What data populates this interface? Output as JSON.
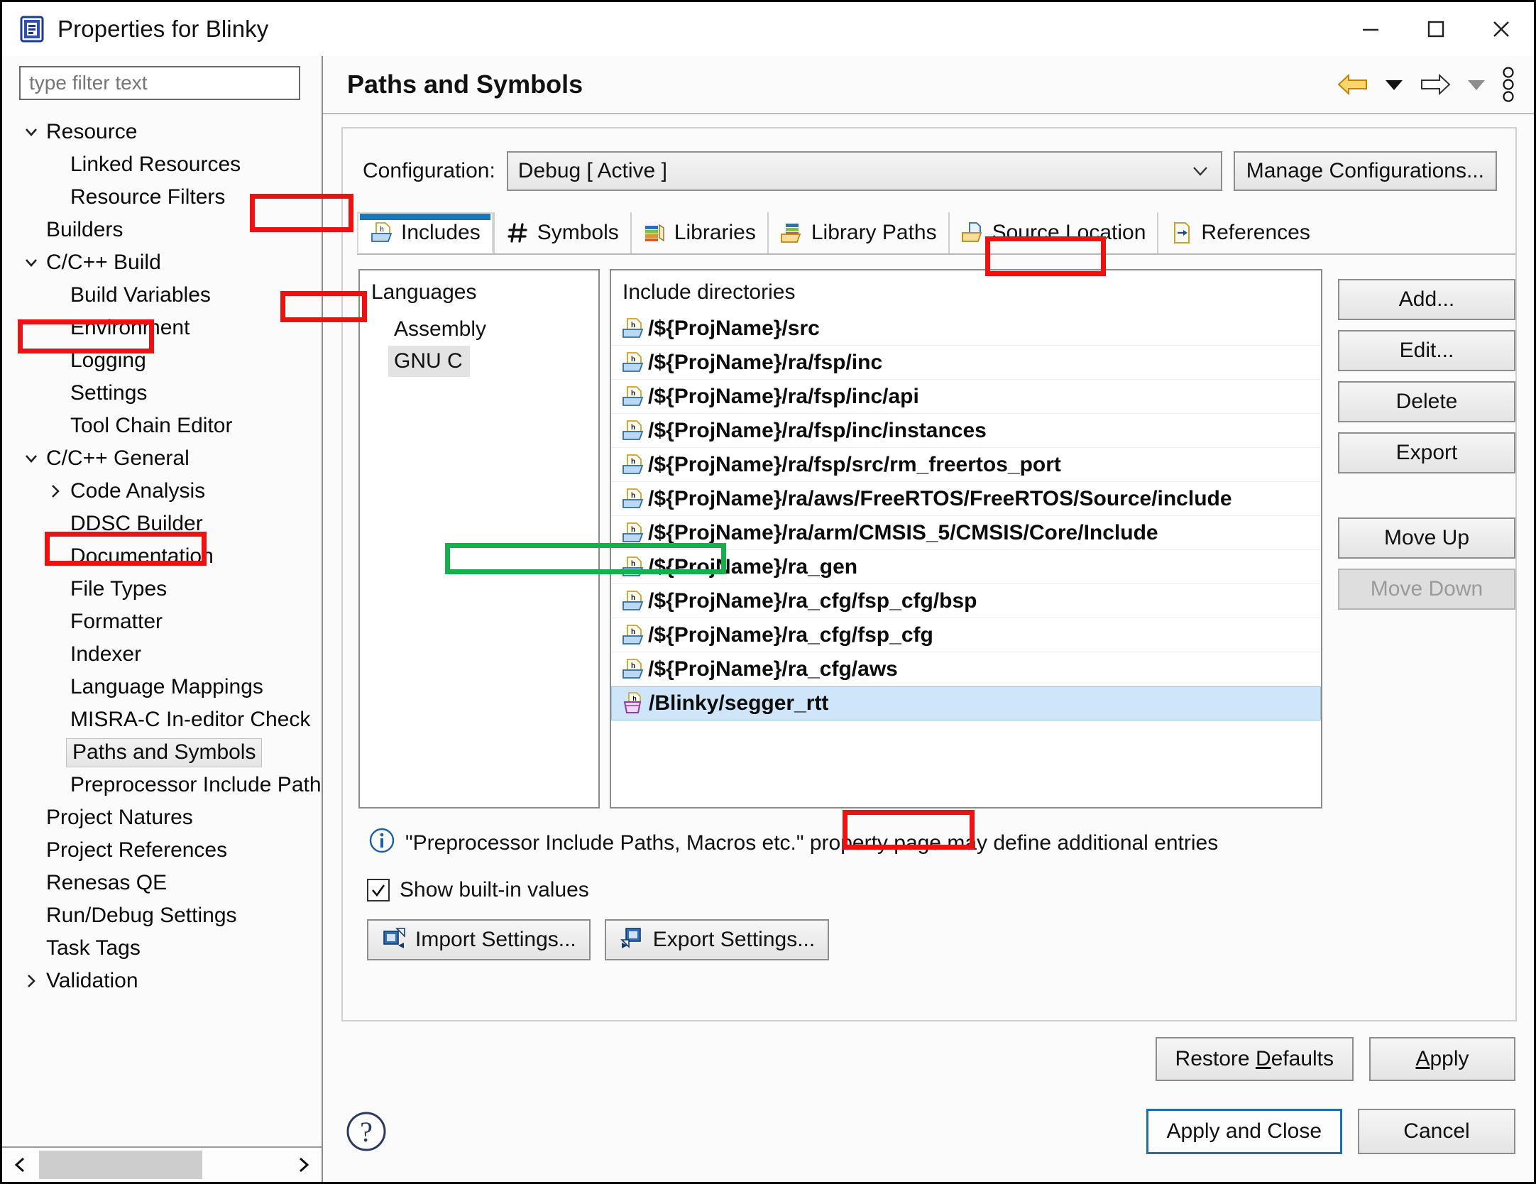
{
  "window": {
    "title": "Properties for Blinky",
    "icon": "properties-icon",
    "minimize": "minimize-icon",
    "maximize": "maximize-icon",
    "close": "close-icon"
  },
  "sidebar": {
    "filter_placeholder": "type filter text",
    "filter_value": "",
    "items": [
      {
        "label": "Resource",
        "level": 0,
        "twisty": "expanded",
        "selected": false
      },
      {
        "label": "Linked Resources",
        "level": 1,
        "twisty": "none",
        "selected": false
      },
      {
        "label": "Resource Filters",
        "level": 1,
        "twisty": "none",
        "selected": false
      },
      {
        "label": "Builders",
        "level": 0,
        "twisty": "none",
        "selected": false
      },
      {
        "label": "C/C++ Build",
        "level": 0,
        "twisty": "expanded",
        "selected": false
      },
      {
        "label": "Build Variables",
        "level": 1,
        "twisty": "none",
        "selected": false
      },
      {
        "label": "Environment",
        "level": 1,
        "twisty": "none",
        "selected": false
      },
      {
        "label": "Logging",
        "level": 1,
        "twisty": "none",
        "selected": false
      },
      {
        "label": "Settings",
        "level": 1,
        "twisty": "none",
        "selected": false
      },
      {
        "label": "Tool Chain Editor",
        "level": 1,
        "twisty": "none",
        "selected": false
      },
      {
        "label": "C/C++ General",
        "level": 0,
        "twisty": "expanded",
        "selected": false
      },
      {
        "label": "Code Analysis",
        "level": 1,
        "twisty": "collapsed",
        "selected": false
      },
      {
        "label": "DDSC Builder",
        "level": 1,
        "twisty": "none",
        "selected": false
      },
      {
        "label": "Documentation",
        "level": 1,
        "twisty": "none",
        "selected": false
      },
      {
        "label": "File Types",
        "level": 1,
        "twisty": "none",
        "selected": false
      },
      {
        "label": "Formatter",
        "level": 1,
        "twisty": "none",
        "selected": false
      },
      {
        "label": "Indexer",
        "level": 1,
        "twisty": "none",
        "selected": false
      },
      {
        "label": "Language Mappings",
        "level": 1,
        "twisty": "none",
        "selected": false
      },
      {
        "label": "MISRA-C In-editor Check",
        "level": 1,
        "twisty": "none",
        "selected": false
      },
      {
        "label": "Paths and Symbols",
        "level": 1,
        "twisty": "none",
        "selected": true
      },
      {
        "label": "Preprocessor Include Path",
        "level": 1,
        "twisty": "none",
        "selected": false
      },
      {
        "label": "Project Natures",
        "level": 0,
        "twisty": "none",
        "selected": false
      },
      {
        "label": "Project References",
        "level": 0,
        "twisty": "none",
        "selected": false
      },
      {
        "label": "Renesas QE",
        "level": 0,
        "twisty": "none",
        "selected": false
      },
      {
        "label": "Run/Debug Settings",
        "level": 0,
        "twisty": "none",
        "selected": false
      },
      {
        "label": "Task Tags",
        "level": 0,
        "twisty": "none",
        "selected": false
      },
      {
        "label": "Validation",
        "level": 0,
        "twisty": "collapsed",
        "selected": false
      }
    ],
    "scroll_left": "scroll-left-icon",
    "scroll_right": "scroll-right-icon"
  },
  "header": {
    "title": "Paths and Symbols",
    "back_icon": "back-arrow-icon",
    "back_menu_icon": "chevron-down-icon",
    "forward_icon": "forward-arrow-icon",
    "forward_menu_icon": "chevron-down-icon",
    "menu_icon": "vertical-dots-icon"
  },
  "configuration": {
    "label": "Configuration:",
    "value": "Debug  [ Active ]",
    "dropdown_icon": "chevron-down-icon",
    "manage_button": "Manage Configurations..."
  },
  "tabs": [
    {
      "label": "Includes",
      "icon": "include-folder-icon",
      "active": true
    },
    {
      "label": "Symbols",
      "icon": "hash-icon",
      "active": false
    },
    {
      "label": "Libraries",
      "icon": "libraries-icon",
      "active": false
    },
    {
      "label": "Library Paths",
      "icon": "library-paths-icon",
      "active": false
    },
    {
      "label": "Source Location",
      "icon": "source-location-icon",
      "active": false
    },
    {
      "label": "References",
      "icon": "references-icon",
      "active": false
    }
  ],
  "languages": {
    "title": "Languages",
    "items": [
      {
        "label": "Assembly",
        "selected": false
      },
      {
        "label": "GNU C",
        "selected": true
      }
    ]
  },
  "includes": {
    "title": "Include directories",
    "entries": [
      {
        "path": "/${ProjName}/src",
        "icon": "include-folder-icon",
        "selected": false
      },
      {
        "path": "/${ProjName}/ra/fsp/inc",
        "icon": "include-folder-icon",
        "selected": false
      },
      {
        "path": "/${ProjName}/ra/fsp/inc/api",
        "icon": "include-folder-icon",
        "selected": false
      },
      {
        "path": "/${ProjName}/ra/fsp/inc/instances",
        "icon": "include-folder-icon",
        "selected": false
      },
      {
        "path": "/${ProjName}/ra/fsp/src/rm_freertos_port",
        "icon": "include-folder-icon",
        "selected": false
      },
      {
        "path": "/${ProjName}/ra/aws/FreeRTOS/FreeRTOS/Source/include",
        "icon": "include-folder-icon",
        "selected": false
      },
      {
        "path": "/${ProjName}/ra/arm/CMSIS_5/CMSIS/Core/Include",
        "icon": "include-folder-icon",
        "selected": false
      },
      {
        "path": "/${ProjName}/ra_gen",
        "icon": "include-folder-icon",
        "selected": false
      },
      {
        "path": "/${ProjName}/ra_cfg/fsp_cfg/bsp",
        "icon": "include-folder-icon",
        "selected": false
      },
      {
        "path": "/${ProjName}/ra_cfg/fsp_cfg",
        "icon": "include-folder-icon",
        "selected": false
      },
      {
        "path": "/${ProjName}/ra_cfg/aws",
        "icon": "include-folder-icon",
        "selected": false
      },
      {
        "path": "/Blinky/segger_rtt",
        "icon": "workspace-folder-icon",
        "selected": true
      }
    ]
  },
  "side_buttons": [
    {
      "label": "Add...",
      "disabled": false
    },
    {
      "label": "Edit...",
      "disabled": false
    },
    {
      "label": "Delete",
      "disabled": false
    },
    {
      "label": "Export",
      "disabled": false
    },
    {
      "label": "Move Up",
      "disabled": false
    },
    {
      "label": "Move Down",
      "disabled": true
    }
  ],
  "info": {
    "icon": "info-icon",
    "text": "\"Preprocessor Include Paths, Macros etc.\" property page may define additional entries"
  },
  "show_builtin": {
    "label": "Show built-in values",
    "checked": true,
    "check_icon": "checkmark-icon"
  },
  "settings_buttons": [
    {
      "label": "Import Settings...",
      "icon": "import-settings-icon"
    },
    {
      "label": "Export Settings...",
      "icon": "export-settings-icon"
    }
  ],
  "apply_row": [
    {
      "label": "Restore Defaults",
      "mnemonic": "D"
    },
    {
      "label": "Apply",
      "mnemonic": "A"
    }
  ],
  "footer": {
    "help_icon": "help-icon",
    "apply_close": "Apply and Close",
    "cancel": "Cancel"
  },
  "annotations": {
    "red": "#ee1111",
    "green": "#16b04a",
    "selection_blue": "#cfe6fa",
    "tab_accent": "#1279bf"
  }
}
